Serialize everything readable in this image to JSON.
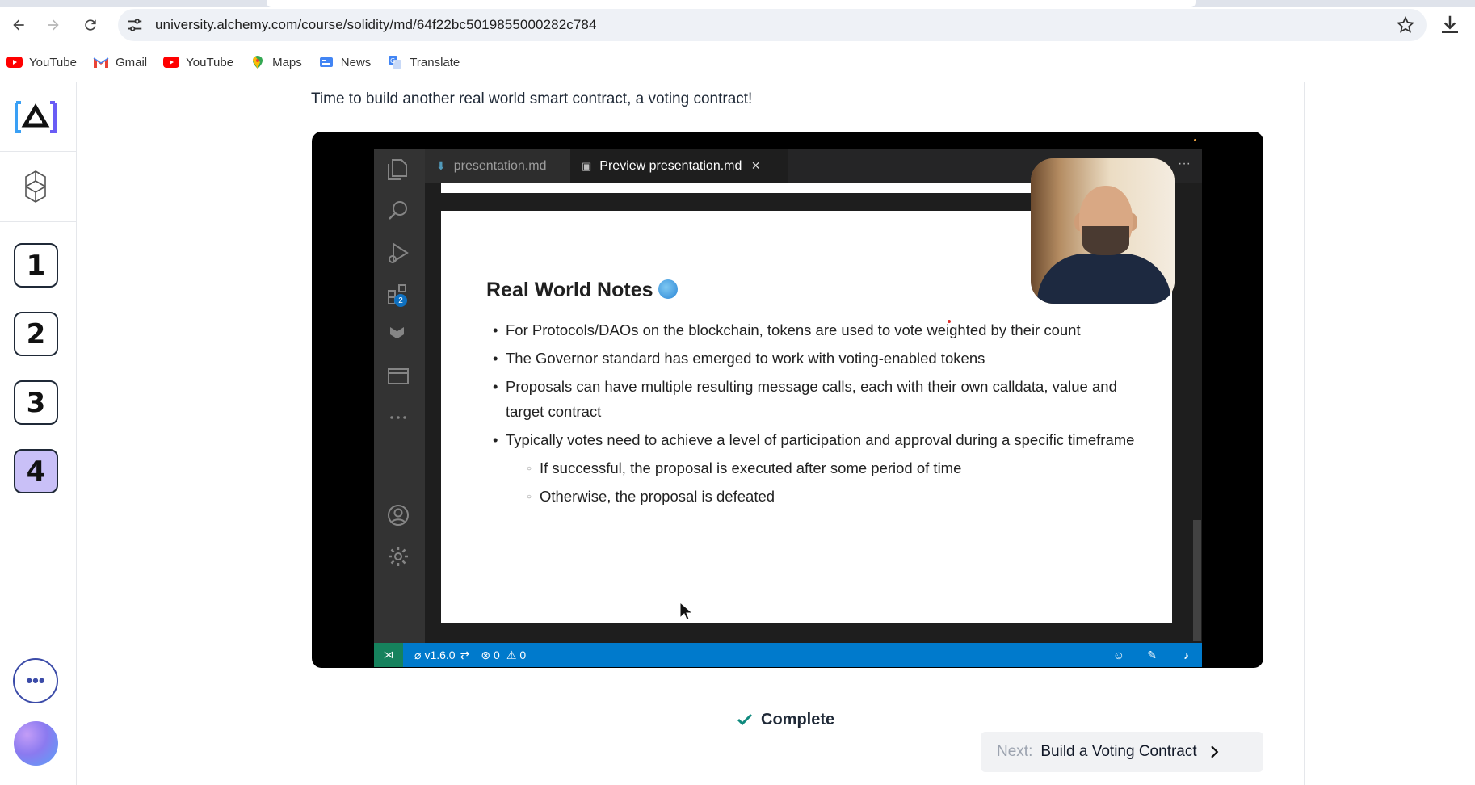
{
  "browser": {
    "url": "university.alchemy.com/course/solidity/md/64f22bc5019855000282c784",
    "bookmarks": [
      {
        "label": "YouTube",
        "icon": "youtube-icon"
      },
      {
        "label": "Gmail",
        "icon": "gmail-icon"
      },
      {
        "label": "YouTube",
        "icon": "youtube-icon"
      },
      {
        "label": "Maps",
        "icon": "maps-icon"
      },
      {
        "label": "News",
        "icon": "news-icon"
      },
      {
        "label": "Translate",
        "icon": "translate-icon"
      }
    ]
  },
  "rail": {
    "steps": [
      "1",
      "2",
      "3",
      "4"
    ],
    "active_step": "4",
    "more_label": "•••"
  },
  "lesson": {
    "intro": "Time to build another real world smart contract, a voting contract!"
  },
  "video": {
    "tabs": [
      {
        "label": "presentation.md",
        "active": false
      },
      {
        "label": "Preview presentation.md",
        "active": true
      }
    ],
    "extensions_badge": "2",
    "slide": {
      "title": "Real World Notes",
      "bullets": [
        "For Protocols/DAOs on the blockchain, tokens are used to vote weighted by their count",
        "The Governor standard has emerged to work with voting-enabled tokens",
        "Proposals can have multiple resulting message calls, each with their own calldata, value and target contract",
        "Typically votes need to achieve a level of participation and approval during a specific timeframe"
      ],
      "sub_bullets": [
        "If successful, the proposal is executed after some period of time",
        "Otherwise, the proposal is defeated"
      ]
    },
    "status": {
      "version": "v1.6.0",
      "errors": "0",
      "warnings": "0"
    }
  },
  "footer": {
    "complete_label": "Complete",
    "next_prefix": "Next:",
    "next_title": "Build a Voting Contract"
  },
  "colors": {
    "vscode_status": "#007acc",
    "active_step_bg": "#c9c0f7",
    "complete_check": "#0f8a7e"
  }
}
